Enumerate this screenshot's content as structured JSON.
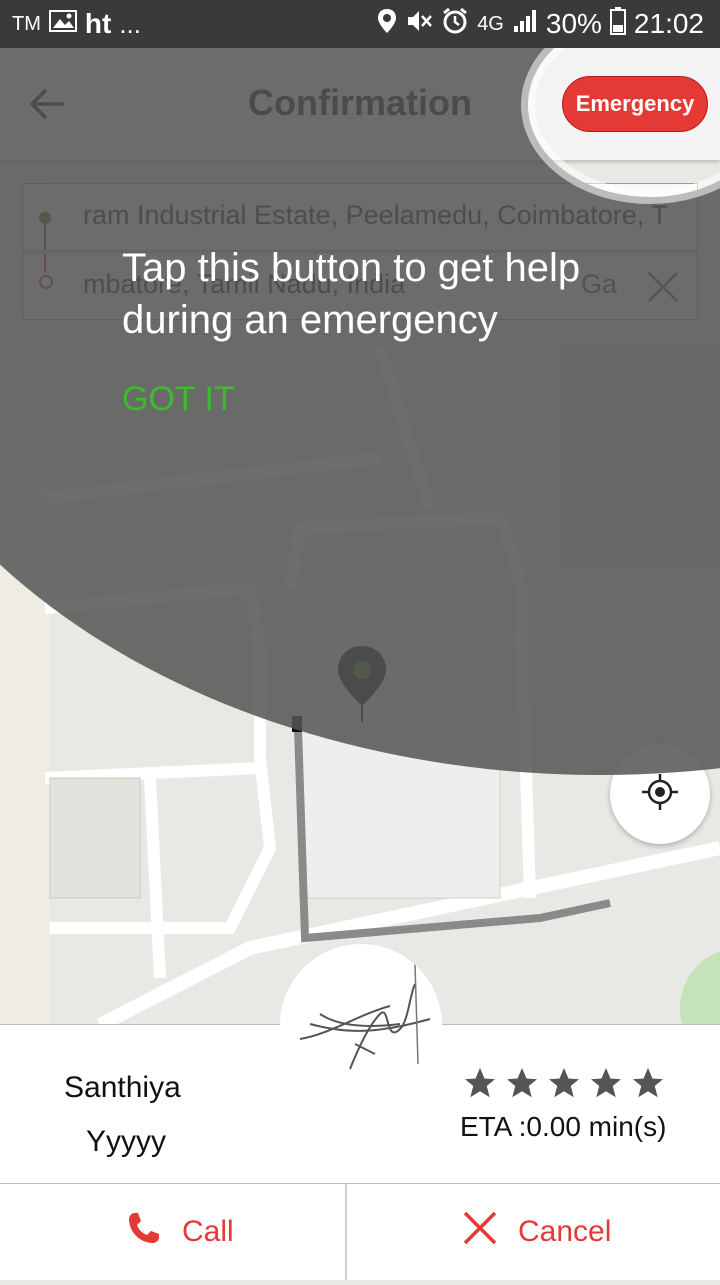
{
  "status_bar": {
    "left_tm": "TM",
    "left_app": "ht",
    "left_more": "...",
    "network": "4G",
    "battery": "30%",
    "time": "21:02"
  },
  "header": {
    "title": "Confirmation",
    "emergency_label": "Emergency"
  },
  "pickup": {
    "address": "ram Industrial Estate, Peelamedu, Coimbatore, T"
  },
  "dropoff": {
    "address": "mbatore, Tamil Nadu, India",
    "trailing": "Ga"
  },
  "tooltip": {
    "message": "Tap this button to get help during an emergency",
    "action": "GOT IT"
  },
  "driver": {
    "first_name": "Santhiya",
    "last_name": "Yyyyy",
    "rating": 5,
    "eta": "ETA :0.00 min(s)"
  },
  "actions": {
    "call": "Call",
    "cancel": "Cancel"
  },
  "colors": {
    "accent_red": "#e53935",
    "got_it_green": "#3dbb2e",
    "overlay": "#5f5f5f"
  }
}
